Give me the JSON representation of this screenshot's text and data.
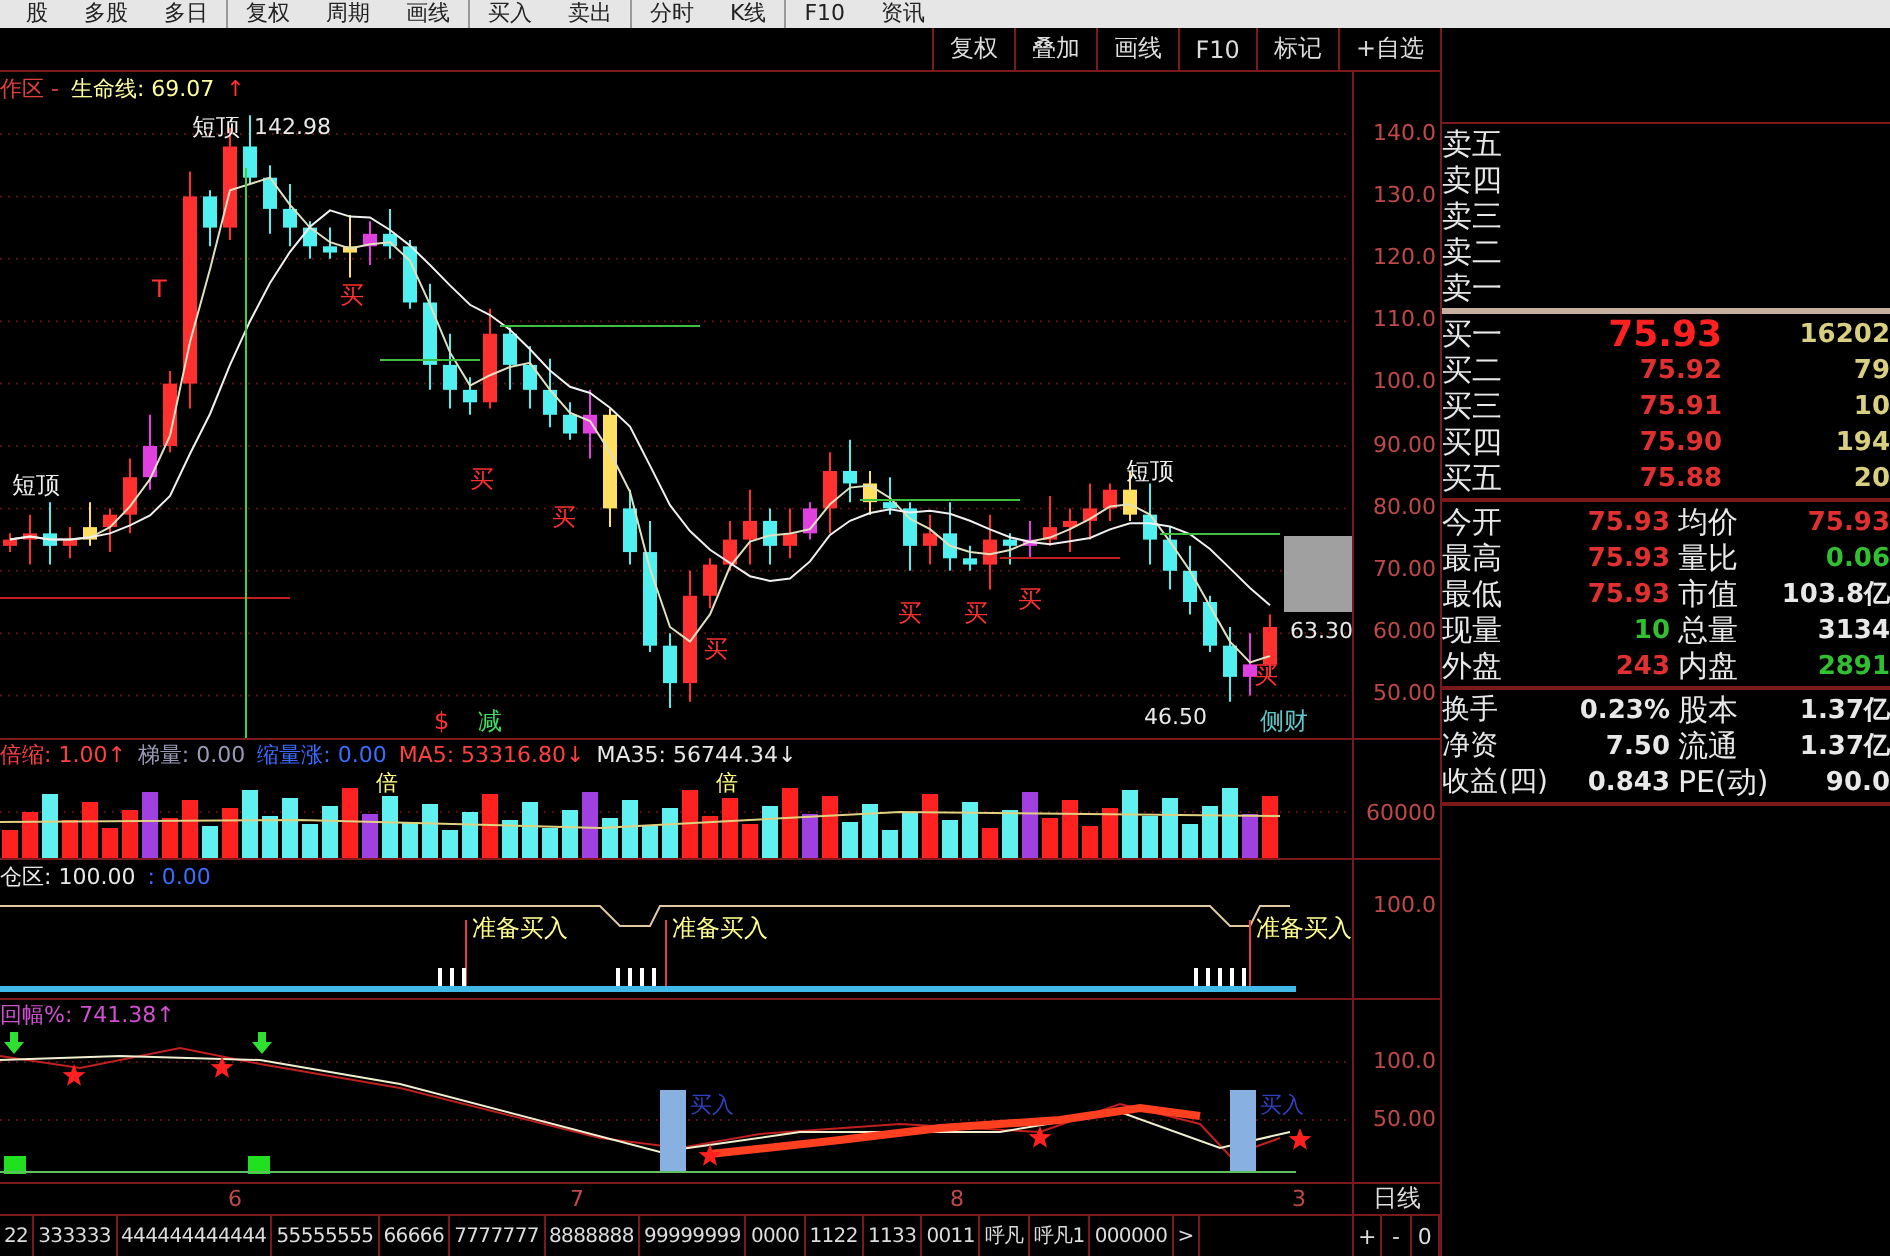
{
  "menu_bar": {
    "items": [
      "股",
      "多股",
      "多日",
      "复权",
      "周期",
      "画线",
      "买入",
      "卖出",
      "分时",
      "K线",
      "F10",
      "资讯"
    ]
  },
  "chart_toolbar": {
    "buttons": [
      "复权",
      "叠加",
      "画线",
      "F10",
      "标记",
      "+自选"
    ]
  },
  "main_chart": {
    "title": {
      "prefix": "作区 -",
      "label": "生命线: 69.07",
      "arrow": "↑"
    },
    "y_ticks": [
      "140.0",
      "130.0",
      "120.0",
      "110.0",
      "100.0",
      "90.00",
      "80.00",
      "70.00",
      "60.00",
      "50.00"
    ],
    "annotations": [
      {
        "text": "短顶",
        "kind": "top"
      },
      {
        "text": "142.98",
        "kind": "price"
      },
      {
        "text": "短顶",
        "kind": "top"
      },
      {
        "text": "短顶",
        "kind": "top"
      },
      {
        "text": "买",
        "kind": "buy"
      },
      {
        "text": "买",
        "kind": "buy"
      },
      {
        "text": "买",
        "kind": "buy"
      },
      {
        "text": "买",
        "kind": "buy"
      },
      {
        "text": "买",
        "kind": "buy"
      },
      {
        "text": "买",
        "kind": "buy"
      },
      {
        "text": "买",
        "kind": "buy"
      },
      {
        "text": "买",
        "kind": "buy"
      },
      {
        "text": "T",
        "kind": "mark"
      },
      {
        "text": "63.30",
        "kind": "price"
      },
      {
        "text": "$",
        "kind": "mark"
      },
      {
        "text": "减",
        "kind": "signal"
      },
      {
        "text": "46.50",
        "kind": "price"
      },
      {
        "text": "侧财",
        "kind": "note"
      }
    ]
  },
  "volume_pane": {
    "indicators": [
      {
        "text": "倍缩: 1.00↑",
        "kind": "red"
      },
      {
        "text": "梯量: 0.00",
        "kind": "gray"
      },
      {
        "text": "缩量涨: 0.00",
        "kind": "blue"
      },
      {
        "text": "MA5: 53316.80↓",
        "kind": "red"
      },
      {
        "text": "MA35: 56744.34↓",
        "kind": "white"
      }
    ],
    "y_ticks": [
      "60000"
    ],
    "annotations": [
      "倍",
      "倍"
    ]
  },
  "position_pane": {
    "indicators": [
      {
        "text": "仓区: 100.00",
        "kind": "white"
      },
      {
        "text": ": 0.00",
        "kind": "blue"
      }
    ],
    "y_ticks": [
      "100.0"
    ],
    "labels": [
      "准备买入",
      "准备买入",
      "准备买入"
    ]
  },
  "swing_pane": {
    "indicators": [
      {
        "text": "回幅%: 741.38↑",
        "kind": "magenta"
      }
    ],
    "y_ticks": [
      "100.0",
      "50.00"
    ],
    "labels": [
      "买入",
      "买入"
    ]
  },
  "date_axis": {
    "labels": [
      "6",
      "7",
      "8",
      "3"
    ],
    "period": "日线"
  },
  "bottom_tabs": {
    "tabs": [
      "22",
      "333333",
      "444444444444",
      "55555555",
      "66666",
      "7777777",
      "8888888",
      "99999999",
      "0000",
      "1122",
      "1133",
      "0011",
      "呼凡",
      "呼凡1",
      "000000",
      ">"
    ],
    "zoom_buttons": [
      "+",
      "-",
      "0"
    ]
  },
  "quote_panel": {
    "sell_levels": [
      "卖五",
      "卖四",
      "卖三",
      "卖二",
      "卖一"
    ],
    "buy_levels": [
      {
        "label": "买一",
        "price": "75.93",
        "volume": "16202"
      },
      {
        "label": "买二",
        "price": "75.92",
        "volume": "79"
      },
      {
        "label": "买三",
        "price": "75.91",
        "volume": "10"
      },
      {
        "label": "买四",
        "price": "75.90",
        "volume": "194"
      },
      {
        "label": "买五",
        "price": "75.88",
        "volume": "20"
      }
    ],
    "stats": [
      {
        "label": "今开",
        "value": "75.93",
        "kind": "rise"
      },
      {
        "label": "均价",
        "value": "75.93",
        "kind": "rise"
      },
      {
        "label": "最高",
        "value": "75.93",
        "kind": "rise"
      },
      {
        "label": "量比",
        "value": "0.06",
        "kind": "fall"
      },
      {
        "label": "最低",
        "value": "75.93",
        "kind": "rise"
      },
      {
        "label": "市值",
        "value": "103.8亿",
        "kind": "plain"
      },
      {
        "label": "现量",
        "value": "10",
        "kind": "fall"
      },
      {
        "label": "总量",
        "value": "3134",
        "kind": "plain"
      },
      {
        "label": "外盘",
        "value": "243",
        "kind": "rise"
      },
      {
        "label": "内盘",
        "value": "2891",
        "kind": "fall"
      }
    ],
    "fundamentals": [
      {
        "label": "换手",
        "value": "0.23%"
      },
      {
        "label": "股本",
        "value": "1.37亿"
      },
      {
        "label": "净资",
        "value": "7.50"
      },
      {
        "label": "流通",
        "value": "1.37亿"
      },
      {
        "label": "收益(四)",
        "value": "0.843"
      },
      {
        "label": "PE(动)",
        "value": "90.0"
      }
    ]
  }
}
